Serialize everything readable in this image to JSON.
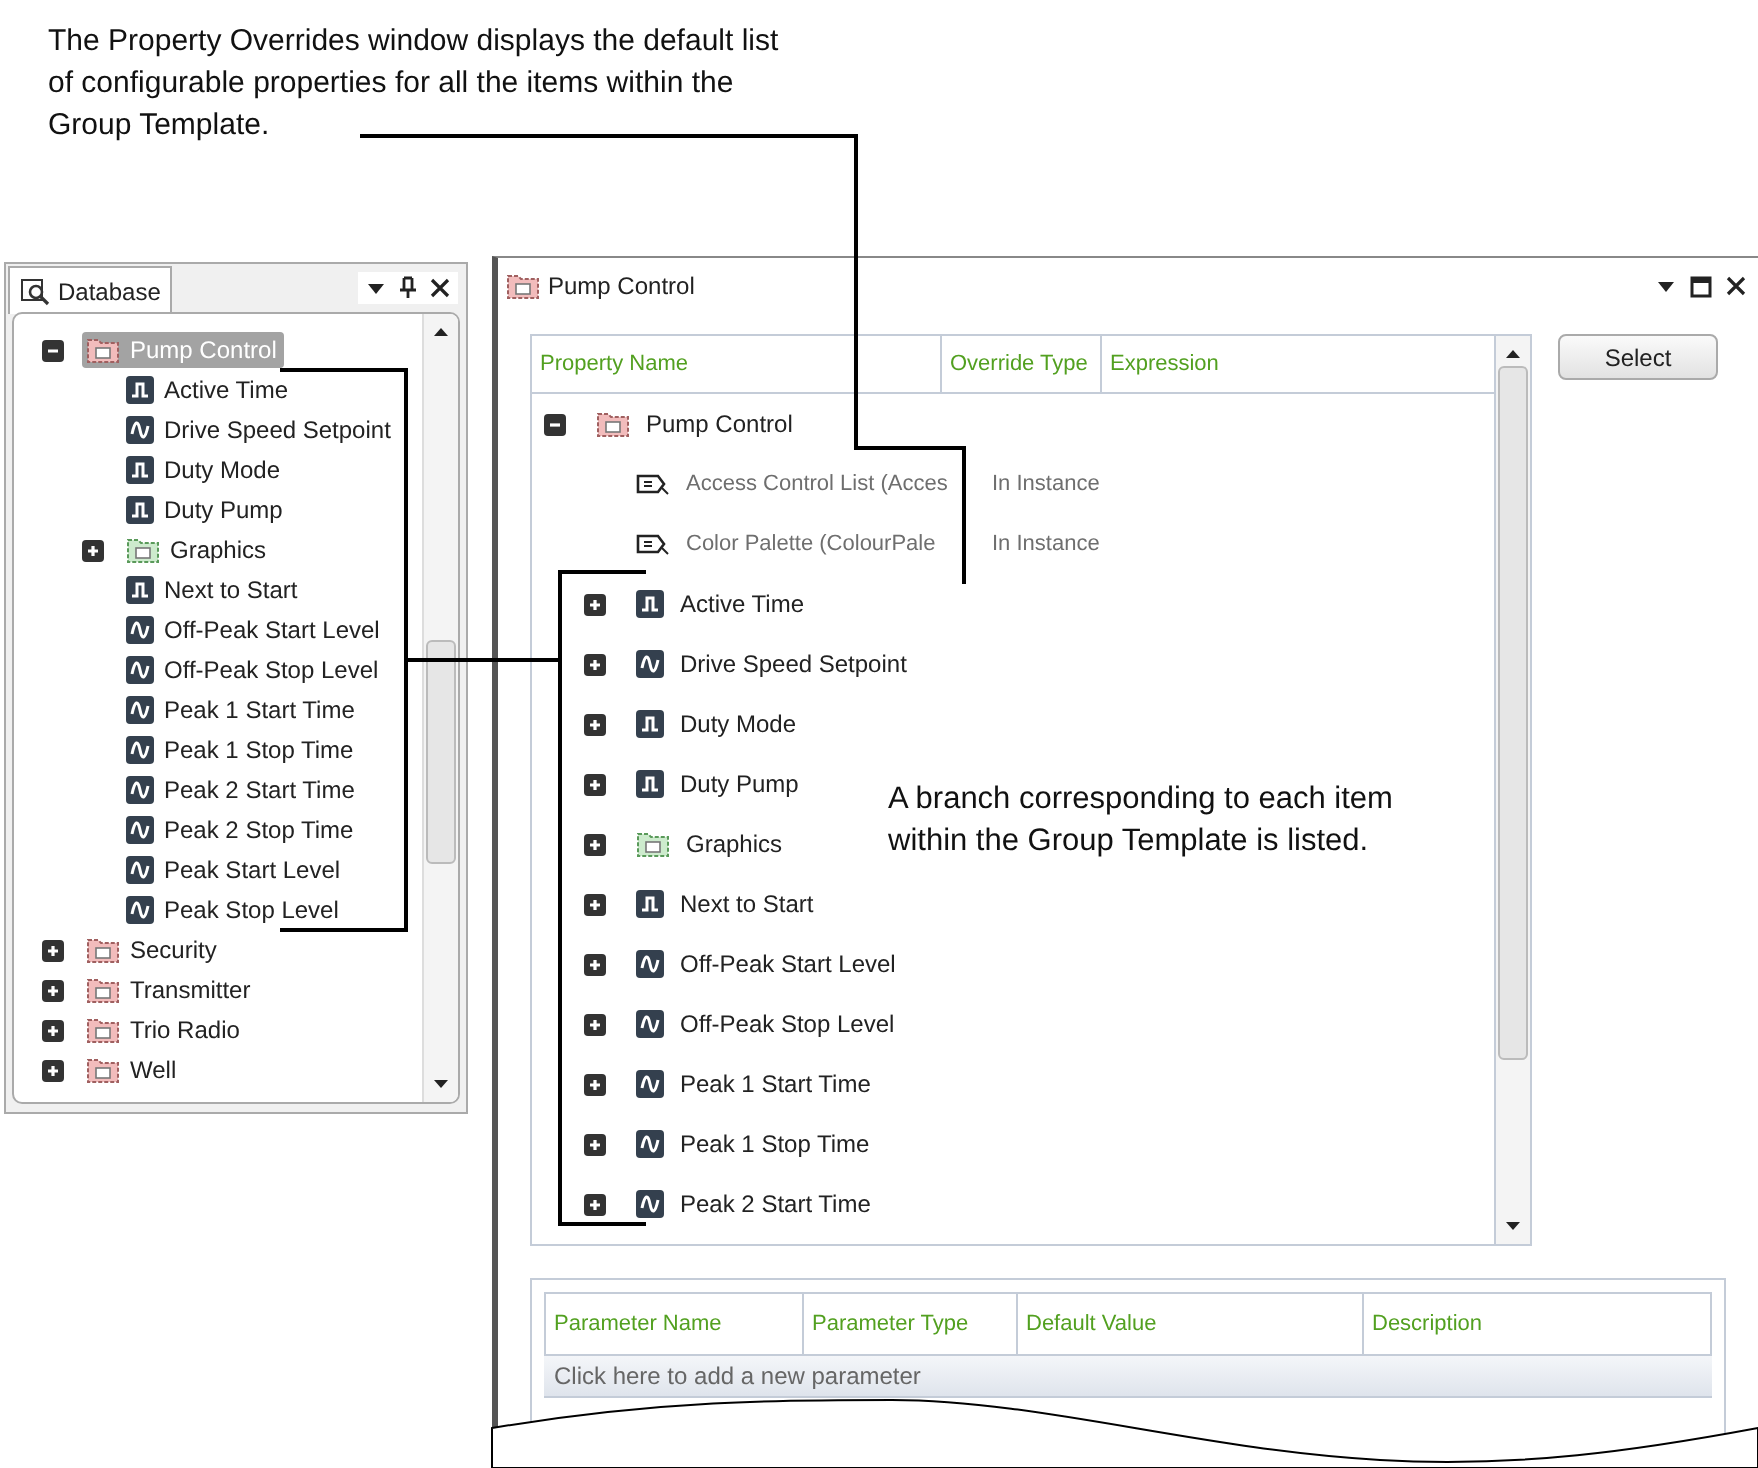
{
  "callouts": [
    {
      "text": "The Property Overrides window displays the default list of configurable properties for all the items within the Group Template."
    },
    {
      "text": "A branch corresponding to each item within the Group Template is listed."
    }
  ],
  "database_panel": {
    "title": "Database",
    "tree": [
      {
        "label": "Pump Control",
        "kind": "group",
        "expanded": true,
        "selected": true,
        "children": [
          {
            "label": "Active Time",
            "kind": "digital",
            "selected": false
          },
          {
            "label": "Drive Speed Setpoint",
            "kind": "analog",
            "selected": false
          },
          {
            "label": "Duty Mode",
            "kind": "digital",
            "selected": false
          },
          {
            "label": "Duty Pump",
            "kind": "digital",
            "selected": false
          },
          {
            "label": "Graphics",
            "kind": "mimic",
            "expanded": false,
            "selected": false
          },
          {
            "label": "Next to Start",
            "kind": "digital",
            "selected": false
          },
          {
            "label": "Off-Peak Start Level",
            "kind": "analog",
            "selected": false
          },
          {
            "label": "Off-Peak Stop Level",
            "kind": "analog",
            "selected": false
          },
          {
            "label": "Peak 1 Start Time",
            "kind": "analog",
            "selected": false
          },
          {
            "label": "Peak 1 Stop Time",
            "kind": "analog",
            "selected": false
          },
          {
            "label": "Peak 2 Start Time",
            "kind": "analog",
            "selected": false
          },
          {
            "label": "Peak 2 Stop Time",
            "kind": "analog",
            "selected": false
          },
          {
            "label": "Peak Start Level",
            "kind": "analog",
            "selected": false
          },
          {
            "label": "Peak Stop Level",
            "kind": "analog",
            "selected": false
          }
        ]
      },
      {
        "label": "Security",
        "kind": "group",
        "expanded": false,
        "selected": false
      },
      {
        "label": "Transmitter",
        "kind": "group",
        "expanded": false,
        "selected": false
      },
      {
        "label": "Trio Radio",
        "kind": "group",
        "expanded": false,
        "selected": false
      },
      {
        "label": "Well",
        "kind": "group",
        "expanded": false,
        "selected": false
      }
    ]
  },
  "overrides_window": {
    "title": "Pump Control",
    "columns": [
      "Property Name",
      "Override Type",
      "Expression"
    ],
    "select_button": "Select",
    "tree": [
      {
        "label": "Pump Control",
        "kind": "group",
        "expanded": true,
        "children": [
          {
            "label": "Access Control List (Acces",
            "kind": "property",
            "override": "In Instance"
          },
          {
            "label": "Color Palette (ColourPale",
            "kind": "property",
            "override": "In Instance"
          },
          {
            "label": "Active Time",
            "kind": "digital",
            "expanded": false
          },
          {
            "label": "Drive Speed Setpoint",
            "kind": "analog",
            "expanded": false
          },
          {
            "label": "Duty Mode",
            "kind": "digital",
            "expanded": false
          },
          {
            "label": "Duty Pump",
            "kind": "digital",
            "expanded": false
          },
          {
            "label": "Graphics",
            "kind": "mimic",
            "expanded": false
          },
          {
            "label": "Next to Start",
            "kind": "digital",
            "expanded": false
          },
          {
            "label": "Off-Peak Start Level",
            "kind": "analog",
            "expanded": false
          },
          {
            "label": "Off-Peak Stop Level",
            "kind": "analog",
            "expanded": false
          },
          {
            "label": "Peak 1 Start Time",
            "kind": "analog",
            "expanded": false
          },
          {
            "label": "Peak 1 Stop Time",
            "kind": "analog",
            "expanded": false
          },
          {
            "label": "Peak 2 Start Time",
            "kind": "analog",
            "expanded": false
          }
        ]
      }
    ],
    "parameters": {
      "columns": [
        "Parameter Name",
        "Parameter Type",
        "Default Value",
        "Description"
      ],
      "add_row": "Click here to add a new parameter"
    }
  }
}
